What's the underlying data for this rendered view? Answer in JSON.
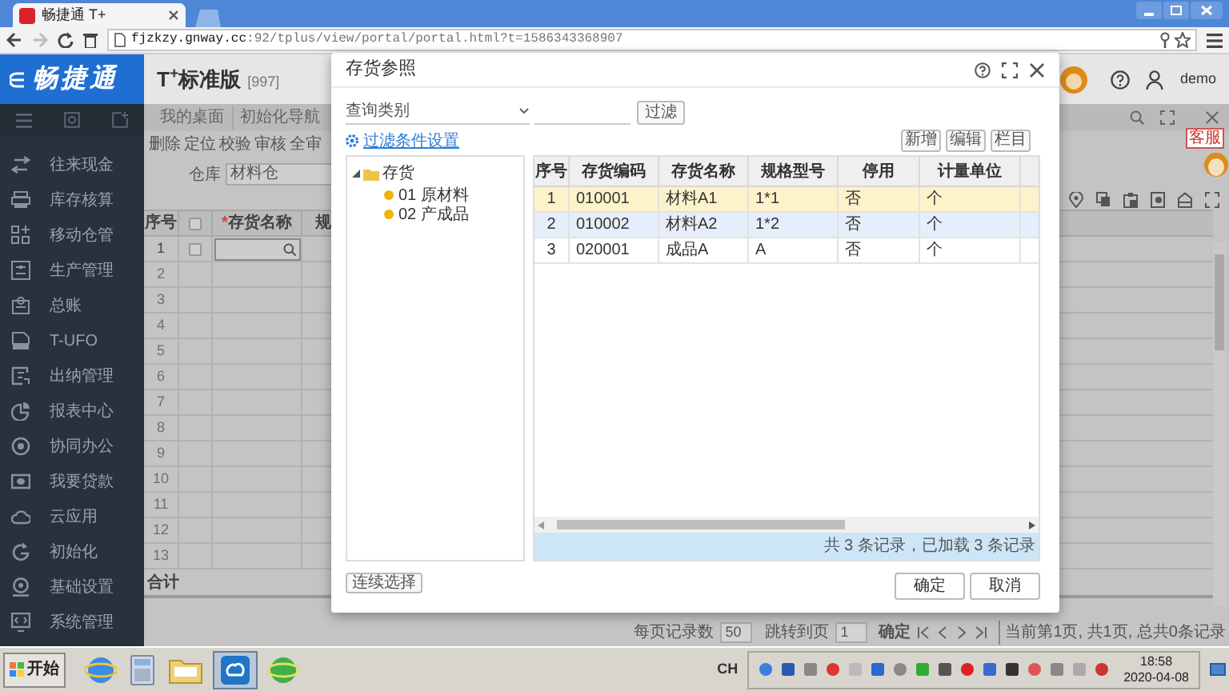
{
  "browser": {
    "tab_title": "畅捷通 T+",
    "url_host": "fjzkzy.gnway.cc",
    "url_rest": ":92/tplus/view/portal/portal.html?t=1586343368907"
  },
  "header": {
    "brand": "畅捷通",
    "product": "T$^{+}$标准版",
    "account": "[997]",
    "user": "demo"
  },
  "sidebar": {
    "items": [
      {
        "label": "往来现金"
      },
      {
        "label": "库存核算"
      },
      {
        "label": "移动仓管"
      },
      {
        "label": "生产管理"
      },
      {
        "label": "总账"
      },
      {
        "label": "T-UFO"
      },
      {
        "label": "出纳管理"
      },
      {
        "label": "报表中心"
      },
      {
        "label": "协同办公"
      },
      {
        "label": "我要贷款"
      },
      {
        "label": "云应用"
      },
      {
        "label": "初始化"
      },
      {
        "label": "基础设置"
      },
      {
        "label": "系统管理"
      }
    ]
  },
  "workspace": {
    "tabs": [
      "我的桌面",
      "初始化导航"
    ],
    "toolbar": [
      "删除",
      "定位",
      "校验",
      "审核",
      "全审"
    ],
    "warehouse": {
      "label": "仓库",
      "value": "材料仓"
    },
    "customer_service": "客服",
    "grid": {
      "columns": [
        "序号",
        "存货名称",
        "规"
      ],
      "required_mark": "*",
      "header_checkbox": {
        "checked": false
      },
      "rows": [
        {
          "number": "1",
          "checkbox": {
            "checked": false
          }
        },
        {
          "number": "2"
        },
        {
          "number": "3"
        },
        {
          "number": "4"
        },
        {
          "number": "5"
        },
        {
          "number": "6"
        },
        {
          "number": "7"
        },
        {
          "number": "8"
        },
        {
          "number": "9"
        },
        {
          "number": "10"
        },
        {
          "number": "11"
        },
        {
          "number": "12"
        },
        {
          "number": "13"
        }
      ],
      "total_label": "合计"
    },
    "pager": {
      "page_size_label": "每页记录数",
      "page_size": "50",
      "jump_label": "跳转到页",
      "page": "1",
      "confirm": "确定",
      "summary": "当前第1页, 共1页, 总共0条记录"
    }
  },
  "dialog": {
    "title": "存货参照",
    "category": {
      "placeholder": "查询类别"
    },
    "filter_button": "过滤",
    "filter_settings_link": "过滤条件设置",
    "actions": [
      "新增",
      "编辑",
      "栏目"
    ],
    "tree": {
      "label": "存货",
      "expanded": true,
      "children": [
        {
          "label": "01 原材料"
        },
        {
          "label": "02 产成品"
        }
      ]
    },
    "table": {
      "columns": [
        "序号",
        "存货编码",
        "存货名称",
        "规格型号",
        "停用",
        "计量单位"
      ],
      "rows": [
        {
          "cells": [
            "1",
            "010001",
            "材料A1",
            "1*1",
            "否",
            "个"
          ],
          "selected": true,
          "hovered": false
        },
        {
          "cells": [
            "2",
            "010002",
            "材料A2",
            "1*2",
            "否",
            "个"
          ],
          "selected": false,
          "hovered": true
        },
        {
          "cells": [
            "3",
            "020001",
            "成品A",
            "A",
            "否",
            "个"
          ],
          "selected": false,
          "hovered": false
        }
      ]
    },
    "status": "共 3 条记录，已加载 3 条记录",
    "continuous_button": "连续选择",
    "ok_button": "确定",
    "cancel_button": "取消"
  },
  "taskbar": {
    "start": "开始",
    "input_language": "CH",
    "time": "18:58",
    "date": "2020-04-08"
  }
}
